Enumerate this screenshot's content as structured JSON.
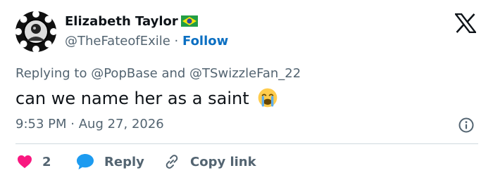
{
  "author": {
    "name": "Elizabeth Taylor",
    "flag_glyph": "🇧🇷",
    "handle": "@TheFateofExile",
    "separator": "·",
    "follow_label": "Follow"
  },
  "reply_context": {
    "prefix": "Replying to",
    "mention_1": "@PopBase",
    "conjunction": "and",
    "mention_2": "@TSwizzleFan_22"
  },
  "tweet": {
    "text": "can we name her as a saint",
    "emoji": "😭"
  },
  "meta": {
    "time": "9:53 PM",
    "separator": "·",
    "date": "Aug 27, 2026"
  },
  "actions": {
    "like_count": "2",
    "reply_label": "Reply",
    "copy_label": "Copy link"
  },
  "colors": {
    "like": "#f91880",
    "reply_icon": "#1d9bf0",
    "follow": "#0b6fc2",
    "secondary_text": "#536471"
  },
  "icons": {
    "avatar": "flower-frame-avatar",
    "logo": "x-logo-icon",
    "info": "info-icon",
    "like": "heart-icon",
    "reply": "speech-bubble-icon",
    "copy": "link-icon"
  }
}
